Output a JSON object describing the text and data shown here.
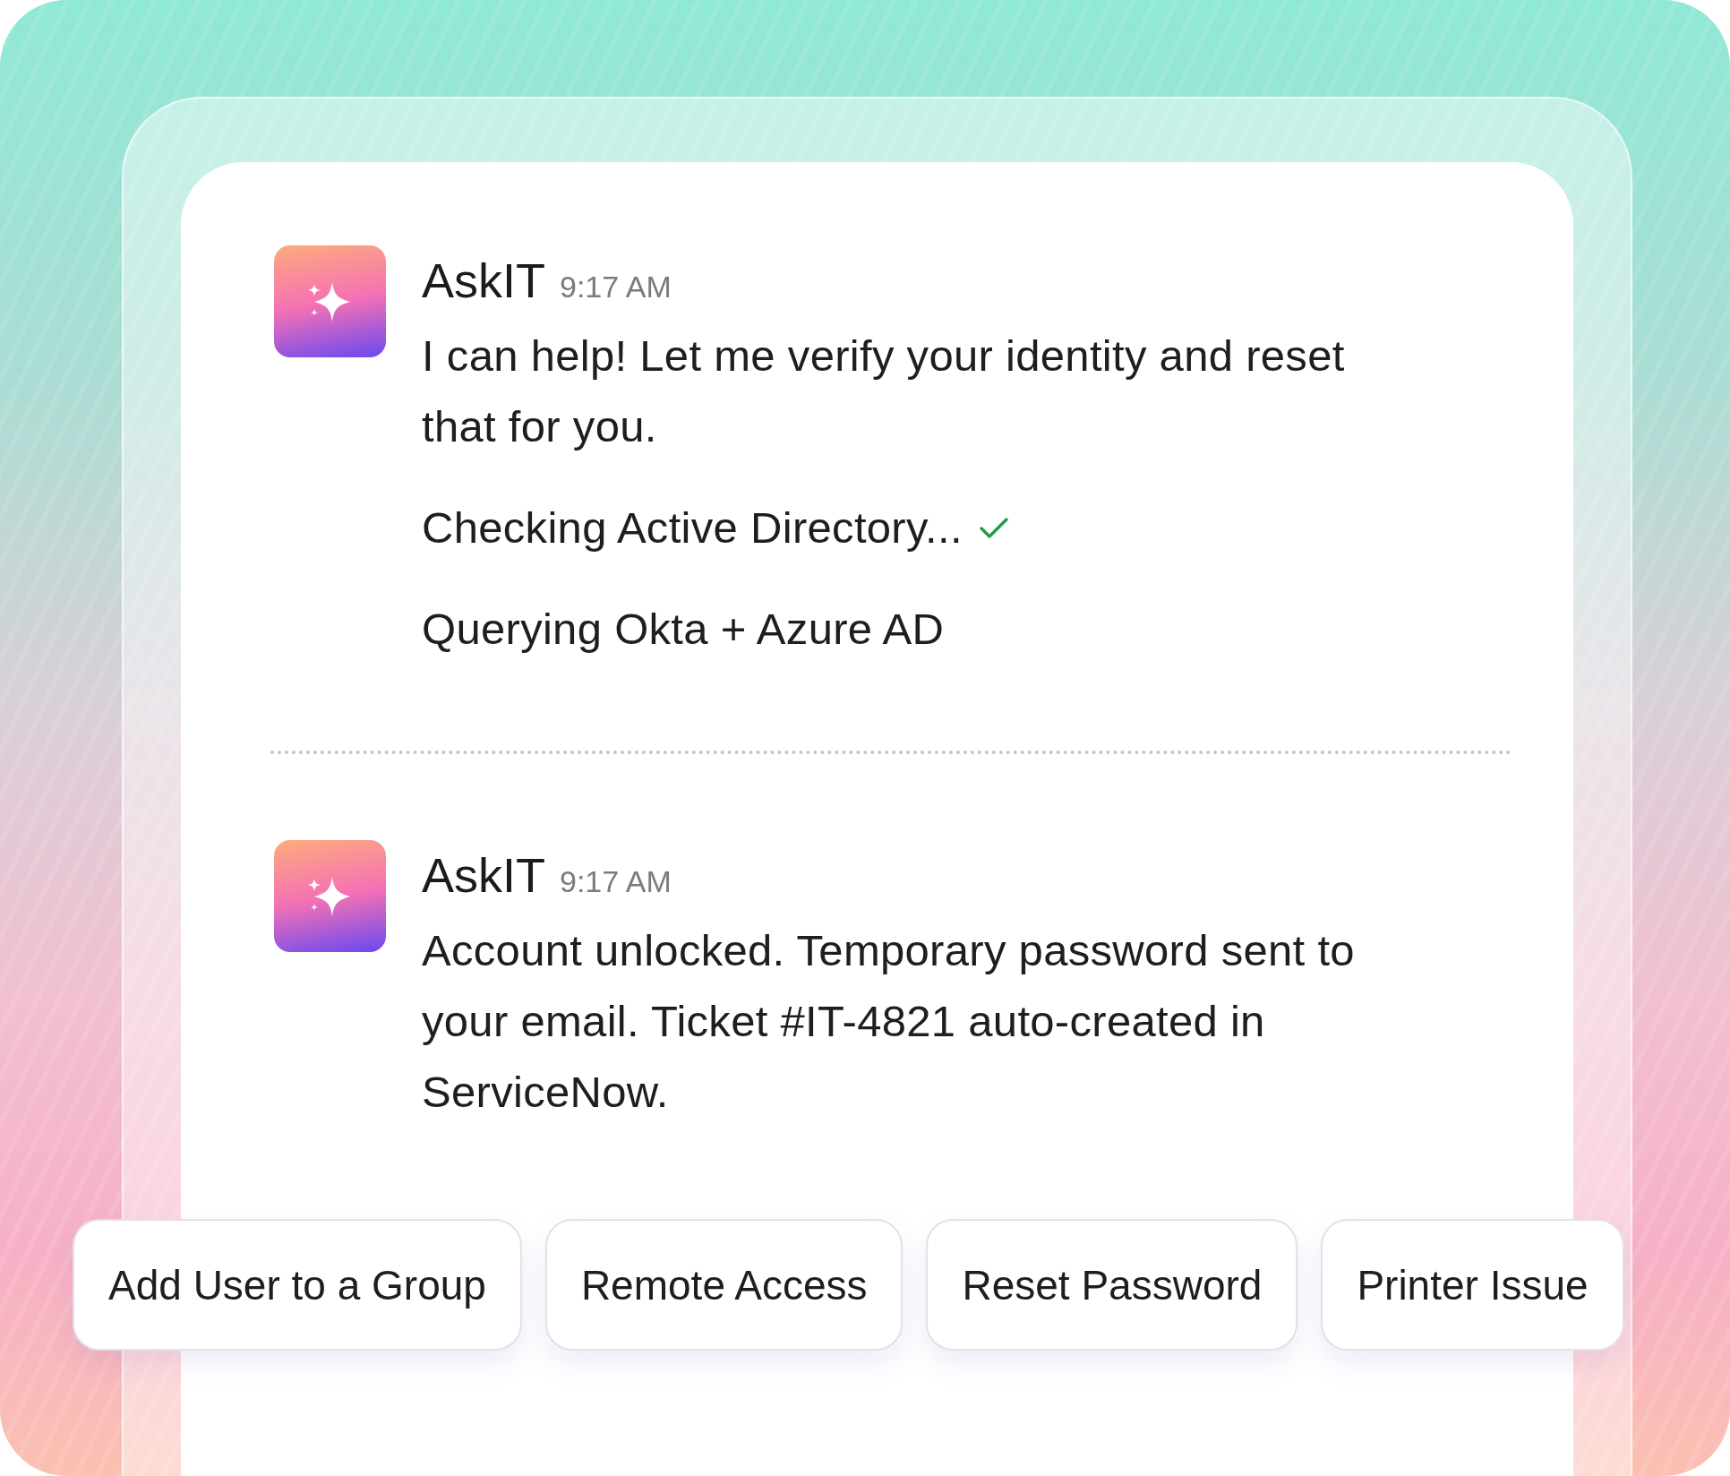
{
  "messages": [
    {
      "sender": "AskIT",
      "time": "9:17 AM",
      "lines": [
        {
          "kind": "text",
          "text": "I can help! Let me verify your identity and reset that for you."
        },
        {
          "kind": "status",
          "text": "Checking Active Directory...",
          "done": true
        },
        {
          "kind": "status",
          "text": "Querying Okta + Azure AD",
          "done": false
        }
      ]
    },
    {
      "sender": "AskIT",
      "time": "9:17 AM",
      "lines": [
        {
          "kind": "text",
          "text": "Account unlocked. Temporary password sent to your email. Ticket #IT-4821 auto-created in ServiceNow."
        }
      ]
    }
  ],
  "suggestions": [
    "Add User to a Group",
    "Remote Access",
    "Reset Password",
    "Printer Issue"
  ]
}
